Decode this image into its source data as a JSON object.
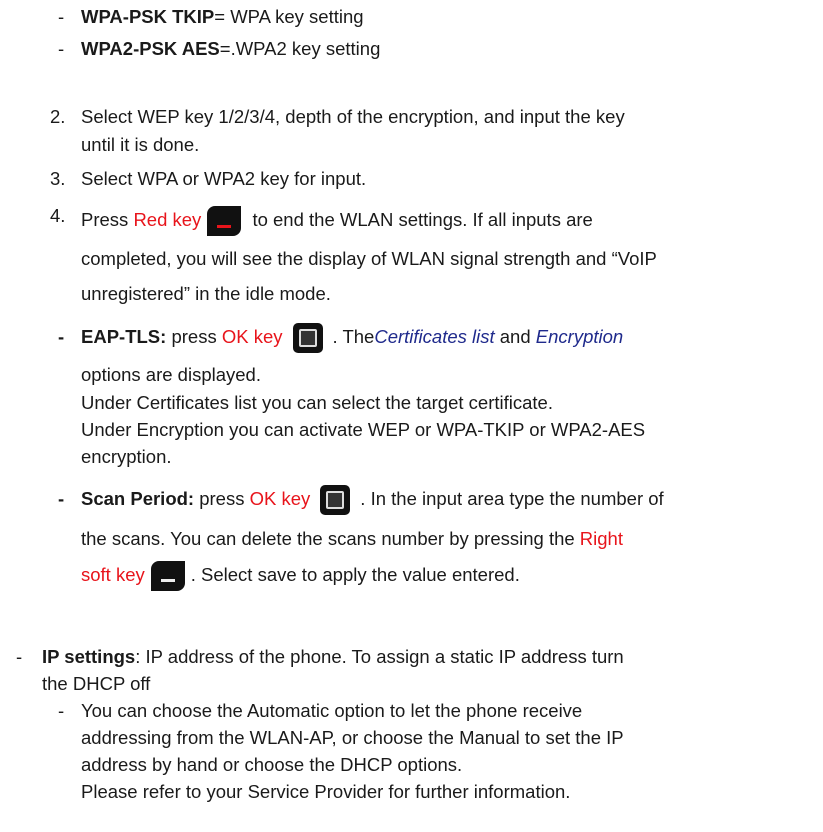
{
  "bullets": {
    "dash": "-",
    "wpa": {
      "label": "WPA-PSK TKIP",
      "text": "= WPA key setting"
    },
    "wpa2": {
      "label": "WPA2-PSK AES",
      "text": "=.WPA2 key setting"
    }
  },
  "steps": {
    "s2": {
      "num": "2.",
      "l1": "Select WEP key 1/2/3/4, depth of the encryption, and input the key",
      "l2": "until it is done."
    },
    "s3": {
      "num": "3.",
      "l1": "Select WPA or WPA2 key for input."
    },
    "s4": {
      "num": "4.",
      "pre": "Press ",
      "red": "Red key",
      "post": " to end the WLAN settings. If all inputs are",
      "l2": "completed, you will see the display of WLAN signal strength and “VoIP",
      "l3": "unregistered” in the idle mode."
    }
  },
  "eap": {
    "label": "EAP-TLS:",
    "pre": " press ",
    "ok": "OK key",
    "the": ". The",
    "cert": "Certificates list",
    "and": " and ",
    "enc": "Encryption",
    "l2": "options are displayed.",
    "l3": "Under Certificates list you can select the target certificate.",
    "l4": "Under Encryption you can activate WEP or WPA-TKIP or WPA2-AES",
    "l5": "encryption."
  },
  "scan": {
    "label": "Scan Period:",
    "pre": " press ",
    "ok": "OK key",
    "post": ". In the input area type the number of",
    "l2a": "the scans. You can delete the scans number  by pressing the ",
    "right": "Right",
    "soft": "soft key",
    "l3": ". Select save to apply the value entered."
  },
  "ip": {
    "dash": "-",
    "label": "IP settings",
    "l1": ": IP address of the phone. To assign a static IP address turn",
    "l2": "the DHCP off",
    "sub1": "You can choose the Automatic option to let the phone receive",
    "sub2": "addressing from the WLAN-AP, or choose the Manual to set the IP",
    "sub3": "address by hand or choose the DHCP options.",
    "sub4": "Please refer to your Service Provider for further information."
  }
}
